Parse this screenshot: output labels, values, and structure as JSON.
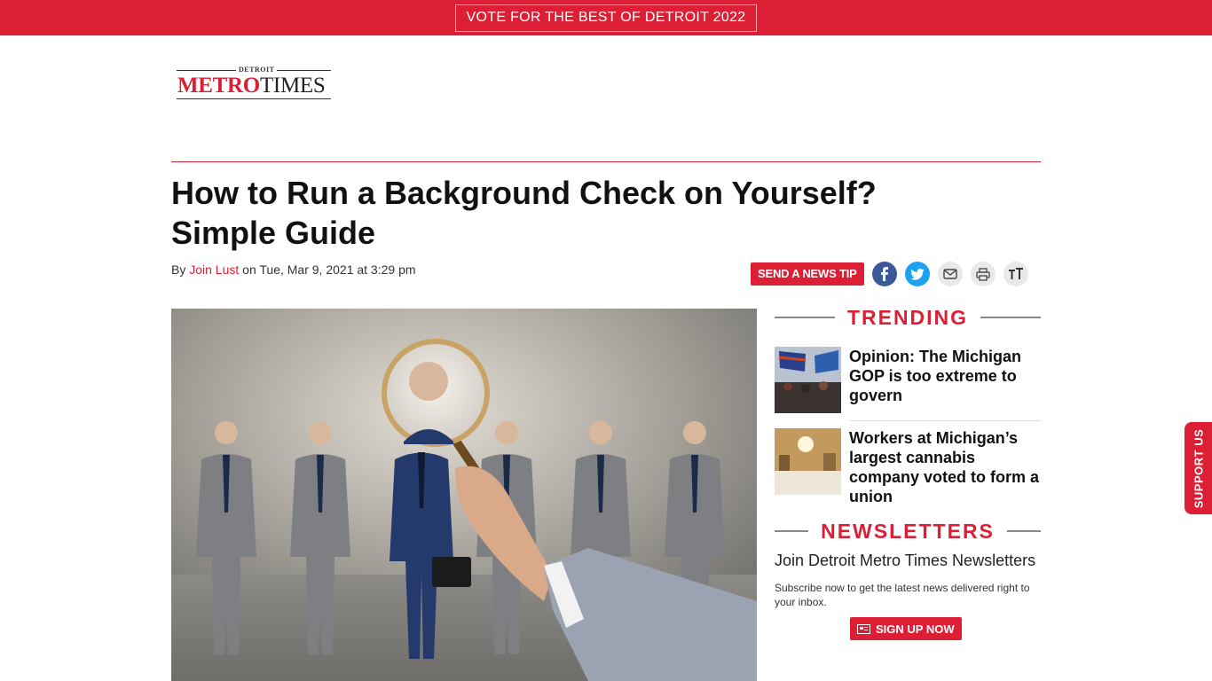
{
  "banner": {
    "vote_label": "VOTE FOR THE BEST OF DETROIT 2022"
  },
  "logo": {
    "small": "DETROIT",
    "metro": "METRO",
    "times": "TIMES"
  },
  "article": {
    "title_line1": "How to Run a Background Check on Yourself?",
    "title_line2": "Simple Guide",
    "by_prefix": "By ",
    "author": "Join Lust",
    "date_text": " on Tue, Mar 9, 2021 at 3:29 pm"
  },
  "tools": {
    "news_tip": "SEND A NEWS TIP",
    "icons": [
      "facebook-icon",
      "twitter-icon",
      "email-icon",
      "print-icon",
      "text-size-icon"
    ]
  },
  "sidebar": {
    "trending_heading": "TRENDING",
    "trending": [
      {
        "title": "Opinion: The Michigan GOP is too extreme to govern"
      },
      {
        "title": "Workers at Michigan’s largest cannabis company voted to form a union"
      }
    ],
    "newsletters_heading": "NEWSLETTERS",
    "newsletter_title": "Join Detroit Metro Times Newsletters",
    "newsletter_sub": "Subscribe now to get the latest news delivered right to your inbox.",
    "signup_label": "SIGN UP NOW"
  },
  "support_tab": "SUPPORT US",
  "colors": {
    "brand_red": "#dc1f35",
    "facebook": "#3b5998",
    "twitter": "#1da1f2"
  }
}
